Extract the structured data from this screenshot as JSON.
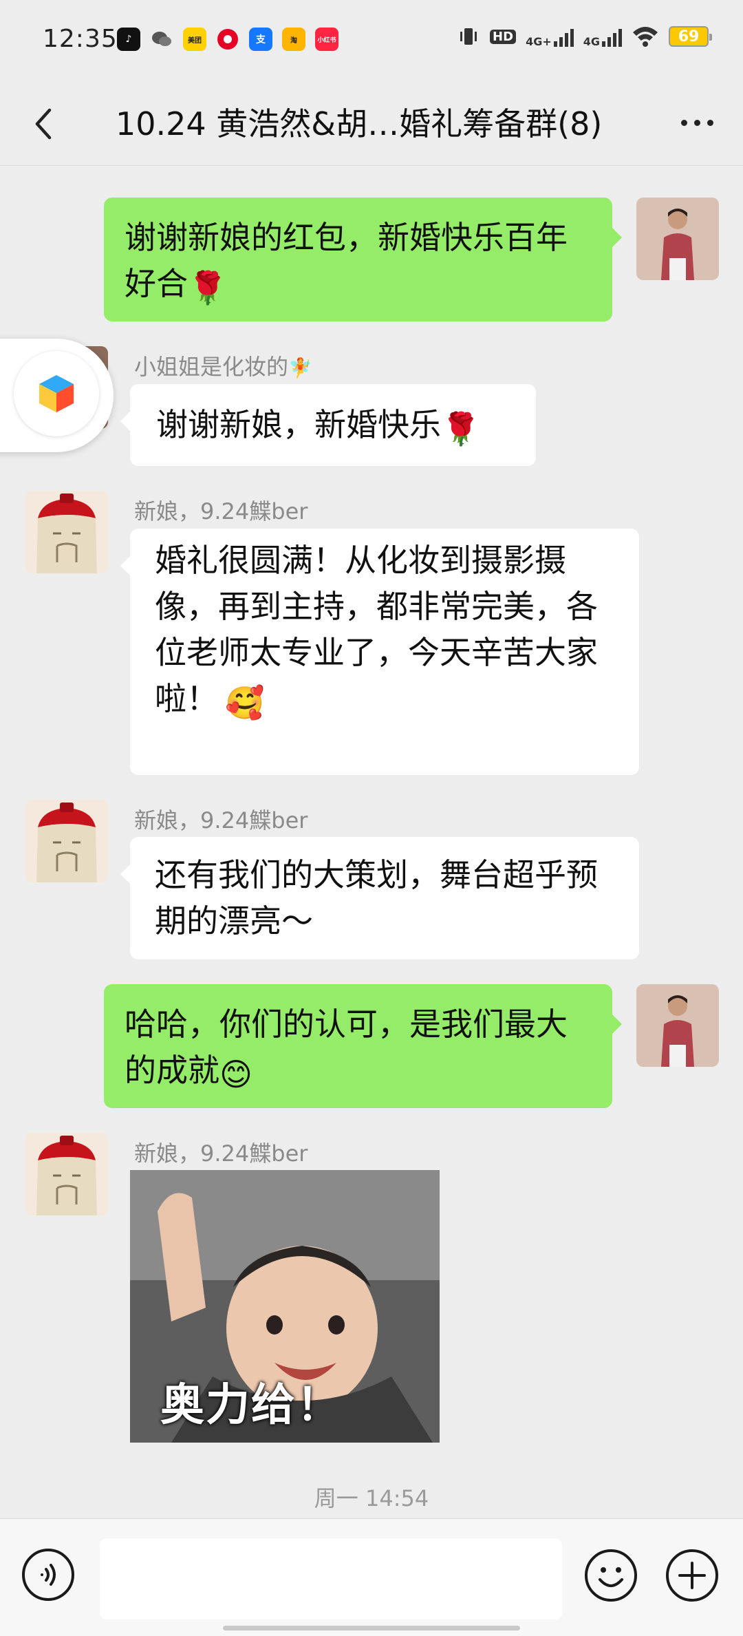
{
  "status_bar": {
    "time": "12:35",
    "battery": "69",
    "network_1": "4G+",
    "network_2": "4G",
    "hd_badge": "HD",
    "app_icons": [
      "douyin-icon",
      "wechat-icon",
      "meituan-icon",
      "netease-music-icon",
      "alipay-icon",
      "taobao-icon",
      "xiaohongshu-icon"
    ]
  },
  "nav": {
    "title": "10.24 黄浩然&胡…婚礼筹备群(8)"
  },
  "messages": [
    {
      "side": "right",
      "text": "谢谢新娘的红包，新婚快乐百年好合",
      "emoji": "🌹"
    },
    {
      "side": "left",
      "sender": "小姐姐是化妆的",
      "sender_emoji": "🧚",
      "text": "谢谢新娘，新婚快乐",
      "emoji": "🌹"
    },
    {
      "side": "left",
      "sender": "新娘，9.24鰈ber",
      "text": "婚礼很圆满！从化妆到摄影摄像，再到主持，都非常完美，各位老师太专业了，今天辛苦大家啦！",
      "emoji": "🥰"
    },
    {
      "side": "left",
      "sender": "新娘，9.24鰈ber",
      "text": "还有我们的大策划，舞台超乎预期的漂亮～"
    },
    {
      "side": "right",
      "text": "哈哈，你们的认可，是我们最大的成就",
      "emoji": "😊"
    },
    {
      "side": "left",
      "sender": "新娘，9.24鰈ber",
      "sticker_caption": "奥力给！"
    }
  ],
  "timestamp": "周一 14:54",
  "input": {
    "value": "",
    "placeholder": ""
  },
  "colors": {
    "background": "#EDEDED",
    "self_bubble": "#95EC69",
    "other_bubble": "#FFFFFF",
    "battery": "#FCC800"
  }
}
